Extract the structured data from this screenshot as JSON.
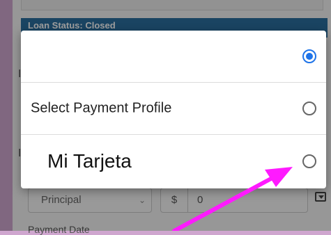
{
  "background": {
    "status_text": "Loan Status: Closed",
    "side_letter_1": "I",
    "side_letter_2": "I",
    "payment_type_select": "Principal",
    "currency_symbol": "$",
    "amount_value": "0",
    "payment_date_label": "Payment Date"
  },
  "dialog": {
    "options": [
      {
        "label": "",
        "selected": true
      },
      {
        "label": "Select Payment Profile",
        "selected": false
      },
      {
        "label": "Mi Tarjeta",
        "selected": false
      }
    ]
  },
  "annotation": {
    "arrow_color": "#ff1aff"
  },
  "colors": {
    "status_bar": "#2b6f9e",
    "radio_selected": "#1e73e8",
    "page_border": "#cfa6cf"
  }
}
